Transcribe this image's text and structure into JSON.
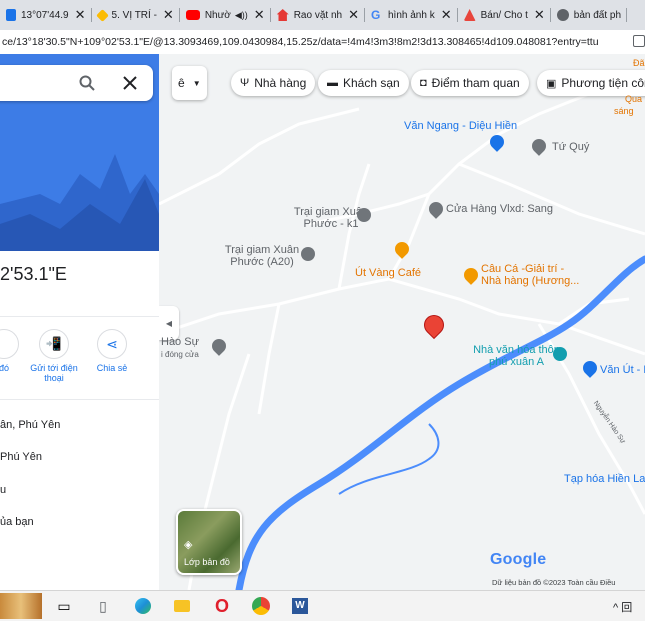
{
  "browser": {
    "tabs": [
      {
        "label": "13°07'44.9",
        "color": "#1a73e8"
      },
      {
        "label": "5. VỊ TRÍ -",
        "color": "#fbbc04"
      },
      {
        "label": "Nhườ",
        "color": "#ff0000"
      },
      {
        "label": "Rao vặt nh",
        "color": "#e53935"
      },
      {
        "label": "hình ảnh k",
        "color": "#4285f4"
      },
      {
        "label": "Bán/ Cho t",
        "color": "#e8453c"
      },
      {
        "label": "bản đất ph",
        "color": "#5f6368"
      }
    ],
    "tab_close": "✕",
    "address": "ce/13°18'30.5\"N+109°02'53.1\"E/@13.3093469,109.0430984,15.25z/data=!4m4!3m3!8m2!3d13.308465!4d109.048081?entry=ttu"
  },
  "sidebar": {
    "coordinate": "2'53.1\"E",
    "actions": [
      {
        "label": "đó"
      },
      {
        "label": "Gửi tới điện thoại"
      },
      {
        "label": "Chia sẻ"
      }
    ],
    "info": [
      {
        "text": "ân, Phú Yên"
      },
      {
        "text": "Phú Yên"
      },
      {
        "text": "u"
      },
      {
        "text": "ủa bạn"
      }
    ]
  },
  "map": {
    "lang_button": "ê",
    "chips": [
      {
        "label": "Nhà hàng",
        "icon": "fork-knife-icon",
        "glyph": "🍴"
      },
      {
        "label": "Khách sạn",
        "icon": "bed-icon",
        "glyph": "🛏"
      },
      {
        "label": "Điểm tham quan",
        "icon": "camera-icon",
        "glyph": "📷"
      },
      {
        "label": "Phương tiện côn",
        "icon": "bus-icon",
        "glyph": "🚌"
      }
    ],
    "places": [
      {
        "name": "Văn Ngang - Diệu Hiền"
      },
      {
        "name": "Tứ Quý"
      },
      {
        "name": "Trại giam Xuân Phước - k1"
      },
      {
        "name": "Cửa Hàng Vlxd: Sang"
      },
      {
        "name": "Trại giam Xuân Phước (A20)"
      },
      {
        "name": "Út Vàng Café"
      },
      {
        "name": "Câu Cá -Giải trí - Nhà hàng (Hương..."
      },
      {
        "name": "Nhà văn hóa thôn phú xuân A"
      },
      {
        "name": "Văn Út - M"
      },
      {
        "name": "Tạp hóa Hiền La"
      },
      {
        "name": "Hào Sự"
      },
      {
        "name": "i đóng cửa"
      },
      {
        "name": "Nguyễn Hào Sự"
      },
      {
        "name": "Đã"
      },
      {
        "name": "Qua"
      },
      {
        "name": "sáng"
      }
    ],
    "layers_label": "Lớp bản đồ",
    "logo": "Google",
    "footer": "Dữ liệu bản đồ ©2023   Toàn cầu   Điều"
  },
  "taskbar": {
    "tray_text": "^ 回"
  }
}
